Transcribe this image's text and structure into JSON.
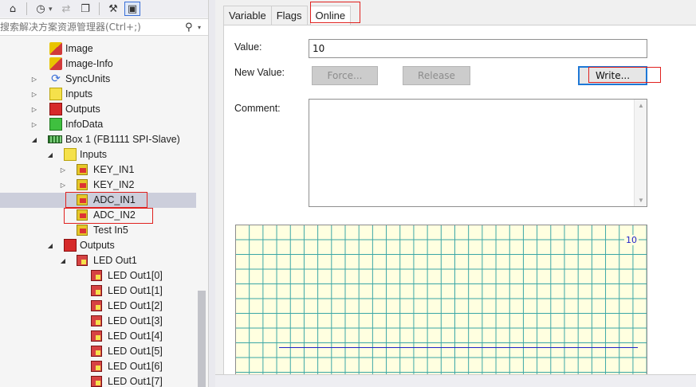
{
  "search": {
    "placeholder": "搜索解决方案资源管理器(Ctrl+;)"
  },
  "tree": {
    "items": [
      {
        "label": "Image"
      },
      {
        "label": "Image-Info"
      },
      {
        "label": "SyncUnits"
      },
      {
        "label": "Inputs"
      },
      {
        "label": "Outputs"
      },
      {
        "label": "InfoData"
      },
      {
        "label": "Box 1 (FB1111 SPI-Slave)"
      },
      {
        "label": "Inputs"
      },
      {
        "label": "KEY_IN1"
      },
      {
        "label": "KEY_IN2"
      },
      {
        "label": "ADC_IN1"
      },
      {
        "label": "ADC_IN2"
      },
      {
        "label": "Test In5"
      },
      {
        "label": "Outputs"
      },
      {
        "label": "LED Out1"
      },
      {
        "label": "LED Out1[0]"
      },
      {
        "label": "LED Out1[1]"
      },
      {
        "label": "LED Out1[2]"
      },
      {
        "label": "LED Out1[3]"
      },
      {
        "label": "LED Out1[4]"
      },
      {
        "label": "LED Out1[5]"
      },
      {
        "label": "LED Out1[6]"
      },
      {
        "label": "LED Out1[7]"
      }
    ]
  },
  "tabs": [
    {
      "label": "Variable"
    },
    {
      "label": "Flags"
    },
    {
      "label": "Online"
    }
  ],
  "online": {
    "value_label": "Value:",
    "value": "10",
    "new_value_label": "New Value:",
    "force_label": "Force...",
    "release_label": "Release",
    "write_label": "Write...",
    "comment_label": "Comment:",
    "graph_value": "10"
  },
  "colors": {
    "highlight": "#e0211f",
    "selection": "#cccedb",
    "graph_bg": "#ffffe0",
    "grid": "#3aa6a6",
    "trace": "#2323c8"
  }
}
